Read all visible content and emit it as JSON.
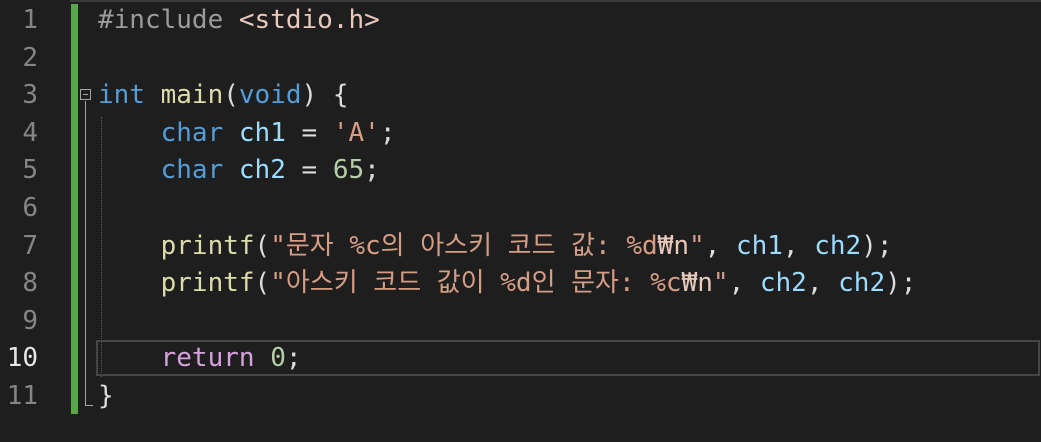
{
  "editor": {
    "active_line": 10,
    "line_numbers": [
      "1",
      "2",
      "3",
      "4",
      "5",
      "6",
      "7",
      "8",
      "9",
      "10",
      "11"
    ],
    "lines": [
      [
        {
          "t": "#include ",
          "c": "pre"
        },
        {
          "t": "<stdio.h>",
          "c": "inc"
        }
      ],
      [],
      [
        {
          "t": "int",
          "c": "kw"
        },
        {
          "t": " ",
          "c": "pun"
        },
        {
          "t": "main",
          "c": "fn"
        },
        {
          "t": "(",
          "c": "pun"
        },
        {
          "t": "void",
          "c": "kw"
        },
        {
          "t": ") {",
          "c": "pun"
        }
      ],
      [
        {
          "t": "    ",
          "c": "pun"
        },
        {
          "t": "char",
          "c": "kw"
        },
        {
          "t": " ",
          "c": "pun"
        },
        {
          "t": "ch1",
          "c": "var"
        },
        {
          "t": " = ",
          "c": "pun"
        },
        {
          "t": "'A'",
          "c": "str"
        },
        {
          "t": ";",
          "c": "pun"
        }
      ],
      [
        {
          "t": "    ",
          "c": "pun"
        },
        {
          "t": "char",
          "c": "kw"
        },
        {
          "t": " ",
          "c": "pun"
        },
        {
          "t": "ch2",
          "c": "var"
        },
        {
          "t": " = ",
          "c": "pun"
        },
        {
          "t": "65",
          "c": "num"
        },
        {
          "t": ";",
          "c": "pun"
        }
      ],
      [],
      [
        {
          "t": "    ",
          "c": "pun"
        },
        {
          "t": "printf",
          "c": "fn"
        },
        {
          "t": "(",
          "c": "pun"
        },
        {
          "t": "\"문자 %c의 아스키 코드 값: %d",
          "c": "str"
        },
        {
          "t": "₩n",
          "c": "esc"
        },
        {
          "t": "\"",
          "c": "str"
        },
        {
          "t": ", ",
          "c": "pun"
        },
        {
          "t": "ch1",
          "c": "var"
        },
        {
          "t": ", ",
          "c": "pun"
        },
        {
          "t": "ch2",
          "c": "var"
        },
        {
          "t": ");",
          "c": "pun"
        }
      ],
      [
        {
          "t": "    ",
          "c": "pun"
        },
        {
          "t": "printf",
          "c": "fn"
        },
        {
          "t": "(",
          "c": "pun"
        },
        {
          "t": "\"아스키 코드 값이 %d인 문자: %c",
          "c": "str"
        },
        {
          "t": "₩n",
          "c": "esc"
        },
        {
          "t": "\"",
          "c": "str"
        },
        {
          "t": ", ",
          "c": "pun"
        },
        {
          "t": "ch2",
          "c": "var"
        },
        {
          "t": ", ",
          "c": "pun"
        },
        {
          "t": "ch2",
          "c": "var"
        },
        {
          "t": ");",
          "c": "pun"
        }
      ],
      [],
      [
        {
          "t": "    ",
          "c": "pun"
        },
        {
          "t": "return",
          "c": "kw-ctrl"
        },
        {
          "t": " ",
          "c": "pun"
        },
        {
          "t": "0",
          "c": "num"
        },
        {
          "t": ";",
          "c": "pun"
        }
      ],
      [
        {
          "t": "}",
          "c": "pun"
        }
      ]
    ]
  }
}
